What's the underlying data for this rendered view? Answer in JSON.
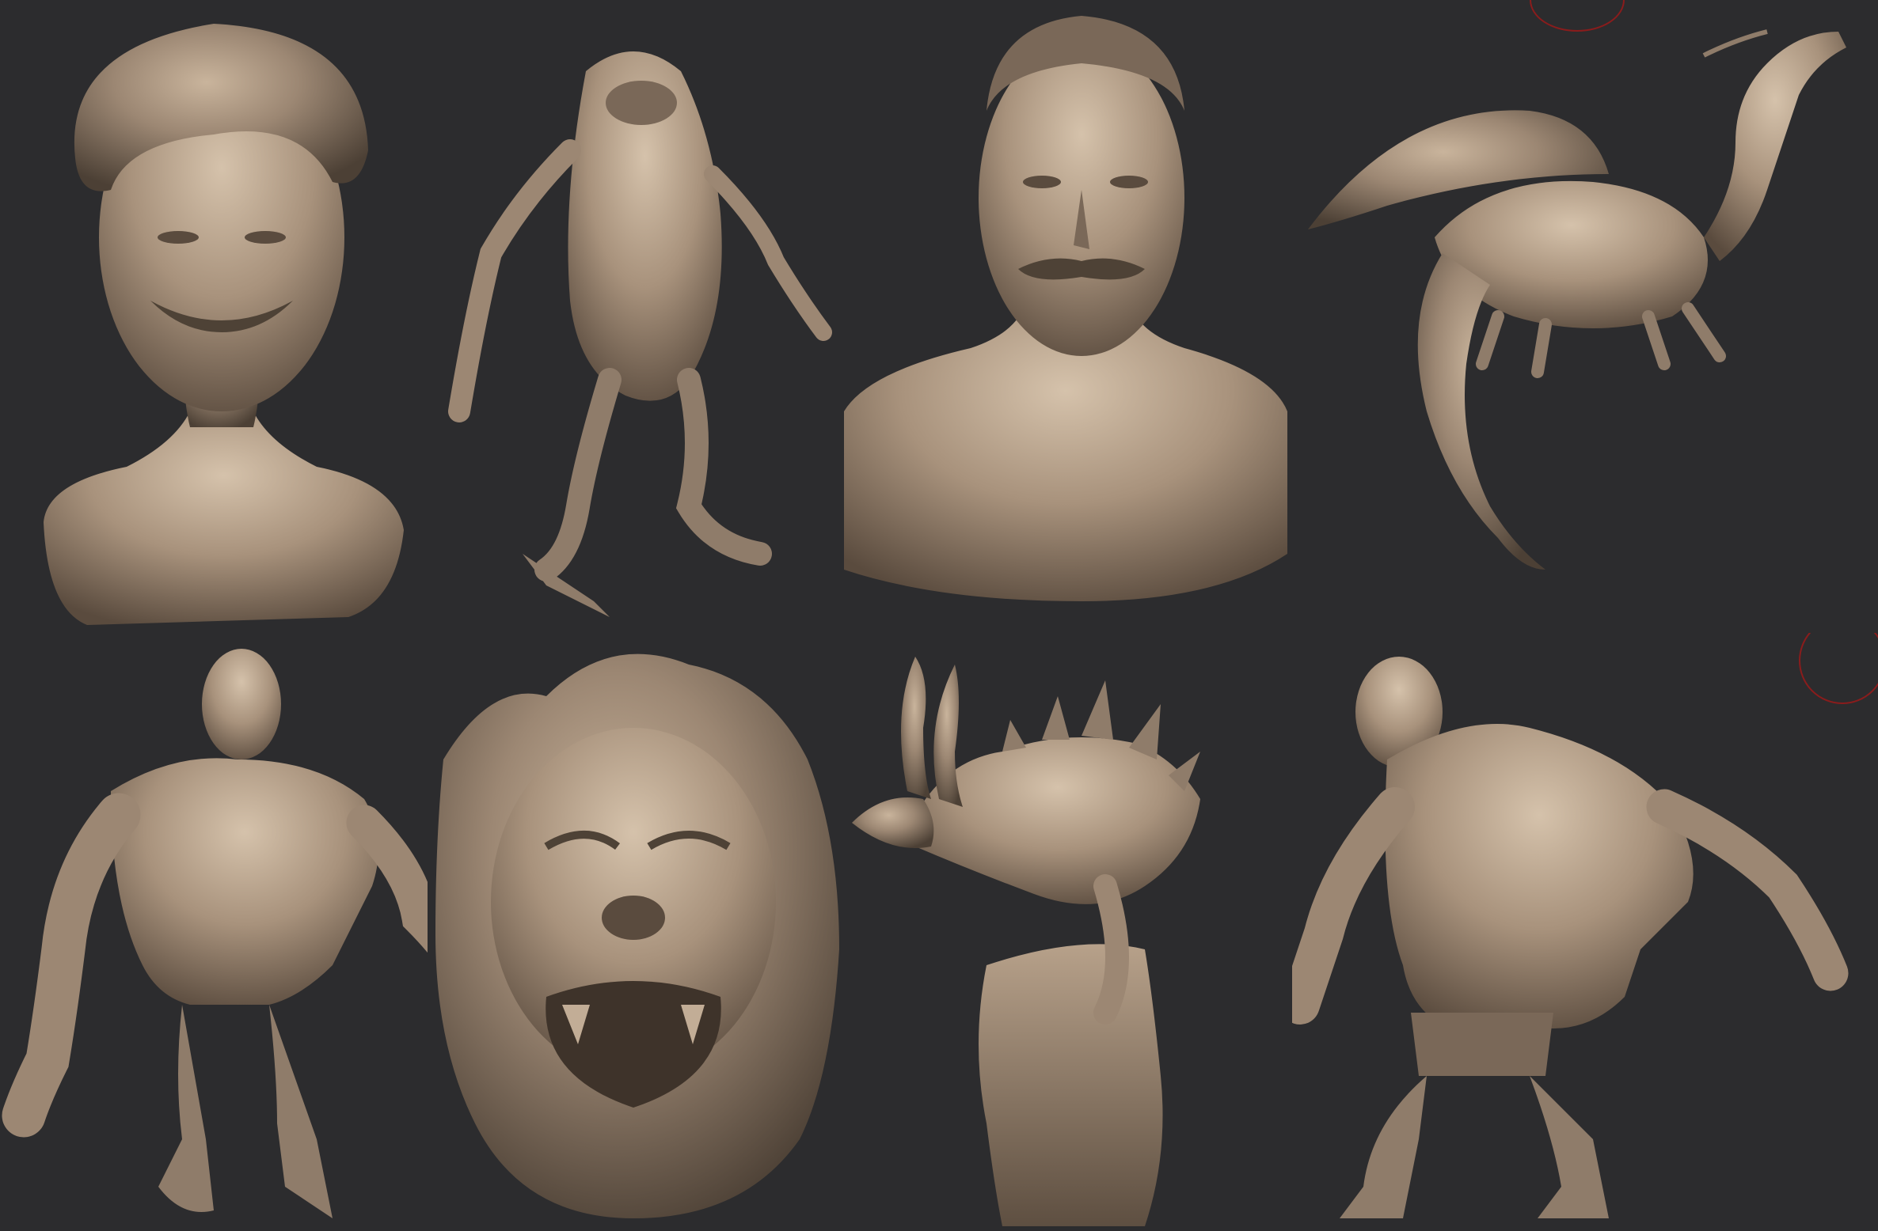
{
  "image": {
    "background_color": "#2c2c2e",
    "clay_color": "#8f7c6a",
    "clay_highlight": "#c2ad96",
    "clay_shadow": "#4e4236",
    "gizmo_color": "#8a1c1c"
  },
  "tiles": [
    {
      "subject": "cartoon-boy-bust"
    },
    {
      "subject": "frog-creature"
    },
    {
      "subject": "mustached-man-bust"
    },
    {
      "subject": "dragon"
    },
    {
      "subject": "orc-figure"
    },
    {
      "subject": "monster-face"
    },
    {
      "subject": "chameleon-on-stump"
    },
    {
      "subject": "ogre-figure"
    }
  ]
}
